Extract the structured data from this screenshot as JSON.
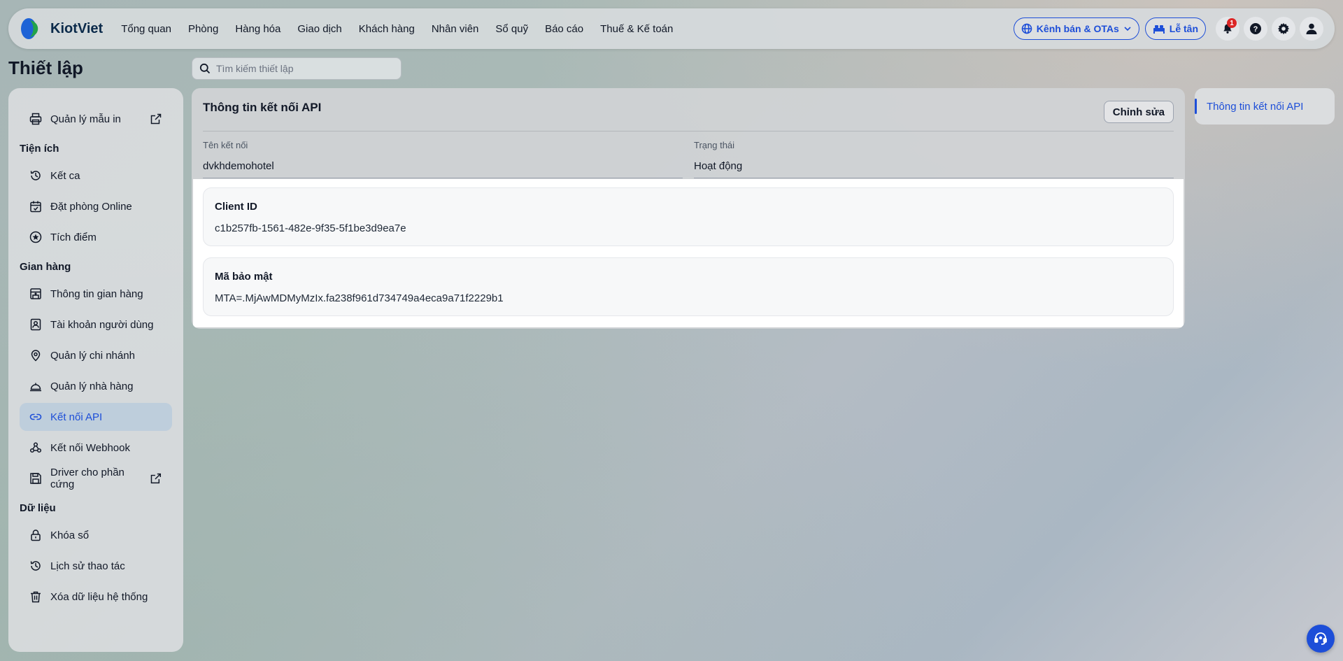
{
  "brand": {
    "name": "KiotViet"
  },
  "nav": {
    "menu": [
      "Tổng quan",
      "Phòng",
      "Hàng hóa",
      "Giao dịch",
      "Khách hàng",
      "Nhân viên",
      "Sổ quỹ",
      "Báo cáo",
      "Thuế & Kế toán"
    ],
    "channel_label": "Kênh bán & OTAs",
    "reception_label": "Lễ tân",
    "notification_count": "1"
  },
  "page": {
    "title": "Thiết lập",
    "search_placeholder": "Tìm kiếm thiết lập"
  },
  "sidebar": {
    "print_templates": "Quản lý mẫu in",
    "sections": {
      "utilities": "Tiện ích",
      "store": "Gian hàng",
      "data": "Dữ liệu"
    },
    "utilities": [
      "Kết ca",
      "Đặt phòng Online",
      "Tích điểm"
    ],
    "store": [
      "Thông tin gian hàng",
      "Tài khoản người dùng",
      "Quản lý chi nhánh",
      "Quản lý nhà hàng",
      "Kết nối API",
      "Kết nối Webhook",
      "Driver cho phần cứng"
    ],
    "data": [
      "Khóa sổ",
      "Lịch sử thao tác",
      "Xóa dữ liệu hệ thống"
    ]
  },
  "main": {
    "title": "Thông tin kết nối API",
    "edit_label": "Chỉnh sửa",
    "connection_name_label": "Tên kết nối",
    "connection_name_value": "dvkhdemohotel",
    "status_label": "Trạng thái",
    "status_value": "Hoạt động",
    "client_id_label": "Client ID",
    "client_id_value": "c1b257fb-1561-482e-9f35-5f1be3d9ea7e",
    "secret_label": "Mã bảo mật",
    "secret_value": "MTA=.MjAwMDMyMzIx.fa238f961d734749a4eca9a71f2229b1"
  },
  "toc": {
    "link": "Thông tin kết nối API"
  },
  "colors": {
    "accent": "#1d4ed8",
    "badge": "#dc2626"
  }
}
